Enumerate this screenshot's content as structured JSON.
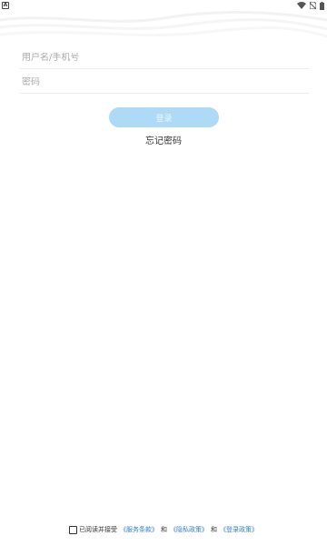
{
  "status_bar": {
    "left_icon": "notification-a-icon",
    "left_icon_text": "A",
    "right_icons": [
      "wifi-icon",
      "no-sim-icon",
      "battery-icon"
    ]
  },
  "form": {
    "username_placeholder": "用户名/手机号",
    "password_placeholder": "密码",
    "login_label": "登录",
    "forgot_label": "忘记密码"
  },
  "agreement": {
    "read_accept": "已阅读并接受",
    "service_terms": "《服务条款》",
    "and1": "和",
    "privacy_policy": "《隐私政策》",
    "and2": "和",
    "login_policy": "《登录政策》"
  },
  "colors": {
    "login_button": "#aedaf5",
    "link": "#2f7fd0"
  }
}
